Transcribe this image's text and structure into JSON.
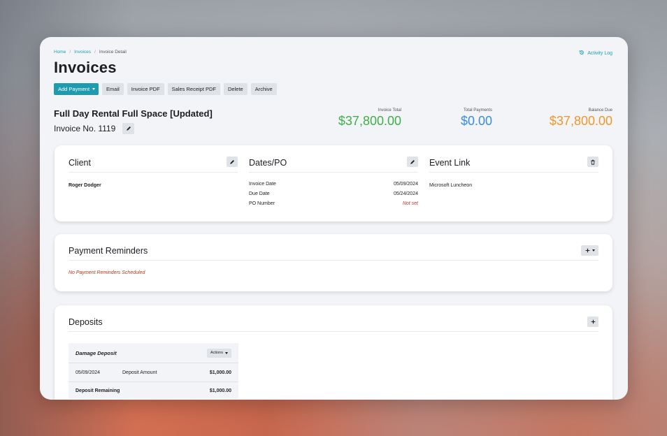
{
  "breadcrumb": {
    "home": "Home",
    "invoices": "Invoices",
    "current": "Invoice Detail",
    "sep": "/"
  },
  "activity_log": "Activity Log",
  "page_title": "Invoices",
  "toolbar": {
    "add_payment": "Add Payment",
    "email": "Email",
    "invoice_pdf": "Invoice PDF",
    "sales_receipt_pdf": "Sales Receipt PDF",
    "delete": "Delete",
    "archive": "Archive"
  },
  "invoice": {
    "title": "Full Day Rental Full Space [Updated]",
    "number": "Invoice No. 1119"
  },
  "totals": {
    "invoice_total_label": "Invoice Total",
    "invoice_total": "$37,800.00",
    "total_payments_label": "Total Payments",
    "total_payments": "$0.00",
    "balance_due_label": "Balance Due",
    "balance_due": "$37,800.00"
  },
  "client": {
    "heading": "Client",
    "name": "Roger Dodger"
  },
  "dates": {
    "heading": "Dates/PO",
    "invoice_date_label": "Invoice Date",
    "invoice_date": "05/09/2024",
    "due_date_label": "Due Date",
    "due_date": "05/24/2024",
    "po_label": "PO Number",
    "po_value": "Not set"
  },
  "event": {
    "heading": "Event Link",
    "name": "Microsoft Luncheon"
  },
  "reminders": {
    "heading": "Payment Reminders",
    "empty": "No Payment Reminders Scheduled"
  },
  "deposits": {
    "heading": "Deposits",
    "item_title": "Damage Deposit",
    "actions": "Actions",
    "date": "05/09/2024",
    "amount_label": "Deposit Amount",
    "amount": "$1,000.00",
    "remaining_label": "Deposit Remaining",
    "remaining": "$1,000.00"
  },
  "colors": {
    "accent": "#1f9bb0",
    "green": "#3fae4a",
    "blue": "#3a8be0",
    "orange": "#f0962b"
  },
  "icons": [
    "pencil-icon",
    "trash-icon",
    "plus-icon",
    "history-icon",
    "chevron-down-icon"
  ]
}
